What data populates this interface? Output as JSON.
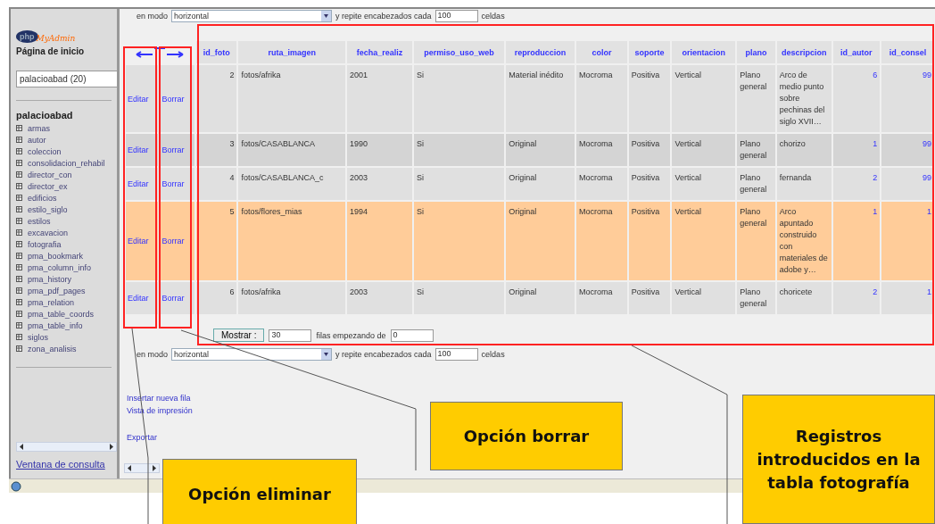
{
  "top_controls": {
    "mode_label": "en modo",
    "mode_value": "horizontal",
    "repeat_label": "y repite encabezados cada",
    "repeat_value": "100",
    "cells_label": "celdas"
  },
  "sidebar": {
    "logo": {
      "mark": "php",
      "name": "MyAdmin"
    },
    "home": "Página de inicio",
    "database_select": "palacioabad (20)",
    "database": "palacioabad",
    "tables": [
      "armas",
      "autor",
      "coleccion",
      "consolidacion_rehabil",
      "director_con",
      "director_ex",
      "edificios",
      "estilo_siglo",
      "estilos",
      "excavacion",
      "fotografia",
      "pma_bookmark",
      "pma_column_info",
      "pma_history",
      "pma_pdf_pages",
      "pma_relation",
      "pma_table_coords",
      "pma_table_info",
      "siglos",
      "zona_analisis"
    ],
    "query_window": "Ventana de consulta"
  },
  "table": {
    "columns": [
      {
        "label": "id_foto",
        "kind": "number"
      },
      {
        "label": "ruta_imagen",
        "kind": "text"
      },
      {
        "label": "fecha_realiz",
        "kind": "text"
      },
      {
        "label": "permiso_uso_web",
        "kind": "text"
      },
      {
        "label": "reproduccion",
        "kind": "text"
      },
      {
        "label": "color",
        "kind": "text"
      },
      {
        "label": "soporte",
        "kind": "text"
      },
      {
        "label": "orientacion",
        "kind": "text"
      },
      {
        "label": "plano",
        "kind": "text"
      },
      {
        "label": "descripcion",
        "kind": "text"
      },
      {
        "label": "id_autor",
        "kind": "link"
      },
      {
        "label": "id_consel",
        "kind": "link"
      }
    ],
    "rows": [
      {
        "edit": "Editar",
        "delete": "Borrar",
        "highlighted": false,
        "cells": [
          "2",
          "fotos/afrika",
          "2001",
          "Si",
          "Material inédito",
          "Mocroma",
          "Positiva",
          "Vertical",
          "Plano general",
          "Arco de medio punto sobre pechinas del siglo XVII…",
          "6",
          "99"
        ]
      },
      {
        "edit": "Editar",
        "delete": "Borrar",
        "highlighted": false,
        "cells": [
          "3",
          "fotos/CASABLANCA",
          "1990",
          "Si",
          "Original",
          "Mocroma",
          "Positiva",
          "Vertical",
          "Plano general",
          "chorizo",
          "1",
          "99"
        ]
      },
      {
        "edit": "Editar",
        "delete": "Borrar",
        "highlighted": false,
        "cells": [
          "4",
          "fotos/CASABLANCA_c",
          "2003",
          "Si",
          "Original",
          "Mocroma",
          "Positiva",
          "Vertical",
          "Plano general",
          "fernanda",
          "2",
          "99"
        ]
      },
      {
        "edit": "Editar",
        "delete": "Borrar",
        "highlighted": true,
        "cells": [
          "5",
          "fotos/flores_mias",
          "1994",
          "Si",
          "Original",
          "Mocroma",
          "Positiva",
          "Vertical",
          "Plano general",
          "Arco apuntado construido con materiales de adobe y…",
          "1",
          "1"
        ]
      },
      {
        "edit": "Editar",
        "delete": "Borrar",
        "highlighted": false,
        "cells": [
          "6",
          "fotos/afrika",
          "2003",
          "Si",
          "Original",
          "Mocroma",
          "Positiva",
          "Vertical",
          "Plano general",
          "choricete",
          "2",
          "1"
        ]
      }
    ]
  },
  "navigation": {
    "show_button": "Mostrar :",
    "rows_value": "30",
    "rows_label": "filas empezando de",
    "start_value": "0",
    "mode_label": "en modo",
    "mode_value": "horizontal",
    "repeat_label": "y repite encabezados cada",
    "repeat_value": "100",
    "cells_label": "celdas"
  },
  "links": [
    "Insertar nueva fila",
    "Vista de impresión"
  ],
  "export_link": "Exportar",
  "callouts": [
    {
      "text": "Opción borrar"
    },
    {
      "text": "Registros introducidos en la tabla fotografía"
    },
    {
      "text": "Opción eliminar"
    }
  ]
}
